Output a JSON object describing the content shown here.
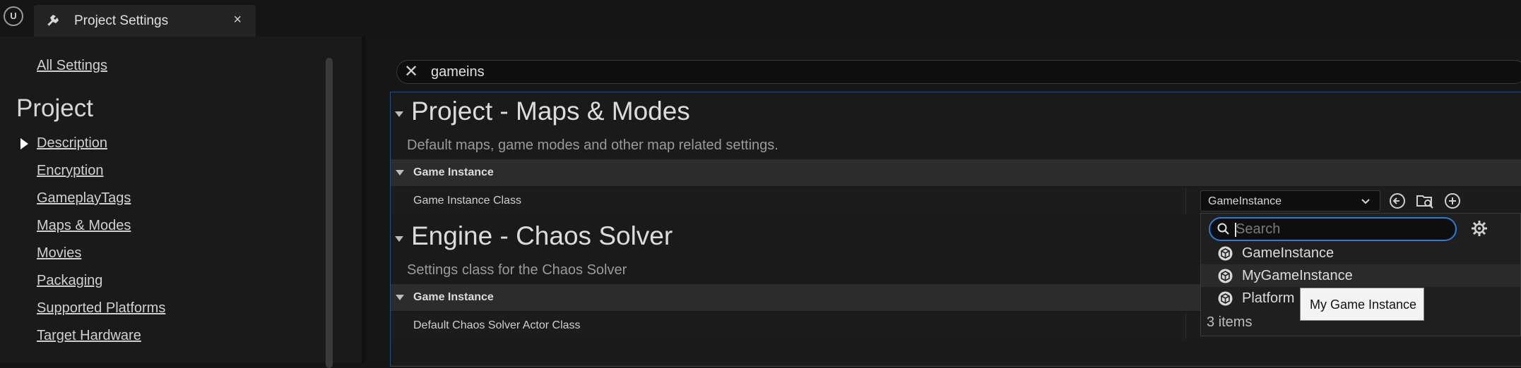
{
  "tab": {
    "title": "Project Settings",
    "close": "×"
  },
  "sidebar": {
    "all_settings": "All Settings",
    "project_heading": "Project",
    "items": [
      {
        "label": "Description"
      },
      {
        "label": "Encryption"
      },
      {
        "label": "GameplayTags"
      },
      {
        "label": "Maps & Modes"
      },
      {
        "label": "Movies"
      },
      {
        "label": "Packaging"
      },
      {
        "label": "Supported Platforms"
      },
      {
        "label": "Target Hardware"
      }
    ]
  },
  "search": {
    "value": "gameins",
    "clear": "✕"
  },
  "sections": [
    {
      "title": "Project - Maps & Modes",
      "description": "Default maps, game modes and other map related settings.",
      "category": "Game Instance",
      "property": "Game Instance Class"
    },
    {
      "title": "Engine - Chaos Solver",
      "description": "Settings class for the Chaos Solver",
      "category": "Game Instance",
      "property": "Default Chaos Solver Actor Class"
    }
  ],
  "combo": {
    "value": "GameInstance",
    "chevron": "⌄"
  },
  "dropdown": {
    "search_placeholder": "Search",
    "items": [
      {
        "label": "GameInstance"
      },
      {
        "label": "MyGameInstance"
      },
      {
        "label": "Platform"
      }
    ],
    "count": "3 items",
    "tooltip": "My Game Instance"
  },
  "icons": {
    "logo": "unreal-logo",
    "tab": "settings-icon",
    "use_selected": "arrow-left-circle-icon",
    "browse": "browse-folder-icon",
    "create_new": "plus-circle-icon",
    "view_options": "gear-icon",
    "class": "class-object-icon"
  },
  "colors": {
    "accent": "#2f7bd8",
    "panel": "#1a1a1a",
    "category": "#2c2c2c",
    "tooltip": "#f4f4f4"
  }
}
